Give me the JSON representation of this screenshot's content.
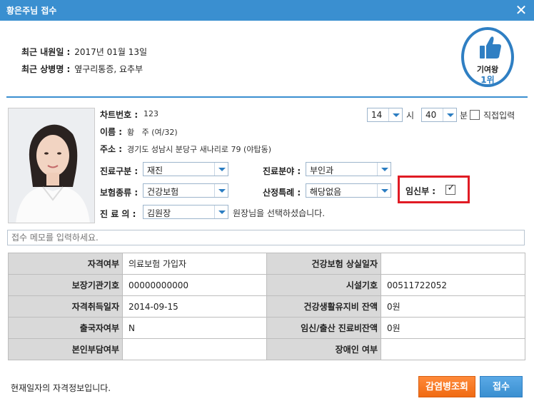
{
  "window": {
    "title": "황은주님 접수"
  },
  "visit": {
    "recent_visit_label": "최근 내원일 :",
    "recent_visit_value": "2017년 01월 13일",
    "recent_disease_label": "최근 상병명 :",
    "recent_disease_value": "옆구리통증, 요추부"
  },
  "badge": {
    "line1": "기여왕",
    "line2": "1위",
    "icon": "thumbs-up-icon",
    "color": "#2f7fc3"
  },
  "patient": {
    "chart_no_label": "차트번호 :",
    "chart_no": "123",
    "name_label": "이름 :",
    "name_value": "황   주 (여/32)",
    "address_label": "주소 :",
    "address_value": "경기도 성남시 분당구 새나리로 79 (야탑동)"
  },
  "time": {
    "hour": "14",
    "hour_unit": "시",
    "minute": "40",
    "minute_unit": "분",
    "direct_input_label": "직접입력"
  },
  "form": {
    "visit_type_label": "진료구분 :",
    "visit_type_value": "재진",
    "department_label": "진료분야 :",
    "department_value": "부인과",
    "insurance_label": "보험종류 :",
    "insurance_value": "건강보험",
    "special_label": "산정특례 :",
    "special_value": "해당없음",
    "pregnant_label": "임신부 :",
    "pregnant_checked": true,
    "doctor_label": "진 료 의 :",
    "doctor_value": "김원장",
    "doctor_note": "원장님을 선택하셨습니다."
  },
  "memo": {
    "placeholder": "접수 메모를 입력하세요."
  },
  "eligibility": {
    "rows": [
      {
        "h1": "자격여부",
        "v1": "의료보험 가입자",
        "h2": "건강보험 상실일자",
        "v2": ""
      },
      {
        "h1": "보장기관기호",
        "v1": "00000000000",
        "h2": "시설기호",
        "v2": "00511722052"
      },
      {
        "h1": "자격취득일자",
        "v1": "2014-09-15",
        "h2": "건강생활유지비 잔액",
        "v2": "0원"
      },
      {
        "h1": "출국자여부",
        "v1": "N",
        "h2": "임신/출산 진료비잔액",
        "v2": "0원"
      },
      {
        "h1": "본인부담여부",
        "v1": "",
        "h2": "장애인 여부",
        "v2": ""
      }
    ]
  },
  "footer": {
    "note": "현재일자의 자격정보입니다.",
    "infection_button": "감염병조회",
    "register_button": "접수"
  },
  "colors": {
    "titlebar": "#3a8fd0",
    "highlight": "#e01b24",
    "orange_button": "#f06a12"
  }
}
